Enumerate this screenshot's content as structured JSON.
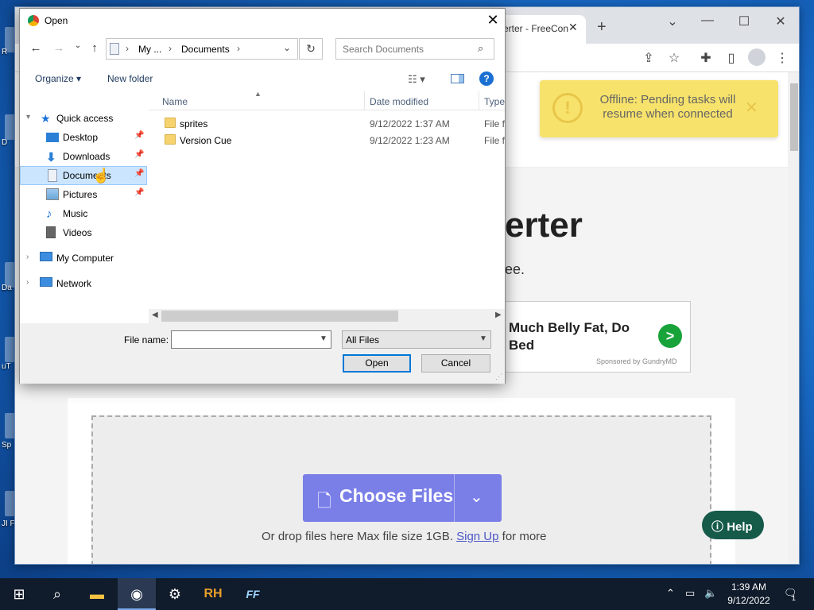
{
  "browser": {
    "tab_title": "erter - FreeCon",
    "tab_close": "✕",
    "new_tab": "+",
    "page": {
      "hero_title": "erter",
      "hero_sub": "ee.",
      "toast_text": "Offline: Pending tasks will resume when connected",
      "toast_icon": "!",
      "toast_close": "✕",
      "ad_text": "Much Belly Fat, Do Bed",
      "ad_go": ">",
      "ad_sponsor": "Sponsored by GundryMD",
      "choose_files": "Choose Files",
      "drop_hint_pre": "Or drop files here Max file size 1GB.",
      "sign_up": "Sign Up",
      "drop_hint_post": "for more",
      "help": "Help"
    }
  },
  "dialog": {
    "title": "Open",
    "address": {
      "seg1": "My ...",
      "seg2": "Documents"
    },
    "search_placeholder": "Search Documents",
    "organize": "Organize ▾",
    "new_folder": "New folder",
    "nav_items": [
      {
        "label": "Quick access",
        "icon": "star-icon"
      },
      {
        "label": "Desktop",
        "icon": "desktop-icon"
      },
      {
        "label": "Downloads",
        "icon": "download-icon"
      },
      {
        "label": "Documents",
        "icon": "documents-icon"
      },
      {
        "label": "Pictures",
        "icon": "pictures-icon"
      },
      {
        "label": "Music",
        "icon": "music-icon"
      },
      {
        "label": "Videos",
        "icon": "videos-icon"
      },
      {
        "label": "My Computer",
        "icon": "computer-icon"
      },
      {
        "label": "Network",
        "icon": "network-icon"
      }
    ],
    "columns": {
      "name": "Name",
      "date": "Date modified",
      "type": "Type"
    },
    "files": [
      {
        "name": "sprites",
        "date": "9/12/2022 1:37 AM",
        "type": "File folder"
      },
      {
        "name": "Version Cue",
        "date": "9/12/2022 1:23 AM",
        "type": "File folder"
      }
    ],
    "file_name_label": "File name:",
    "file_name_value": "",
    "file_type": "All Files",
    "open_btn": "Open",
    "cancel_btn": "Cancel"
  },
  "taskbar": {
    "time": "1:39 AM",
    "date": "9/12/2022",
    "notif_count": "1",
    "app_rh": "RH",
    "app_ff": "FF"
  },
  "desktop": {
    "labels": [
      "R",
      "D",
      "Da",
      "uT",
      "Sp",
      "JI Fl"
    ]
  }
}
